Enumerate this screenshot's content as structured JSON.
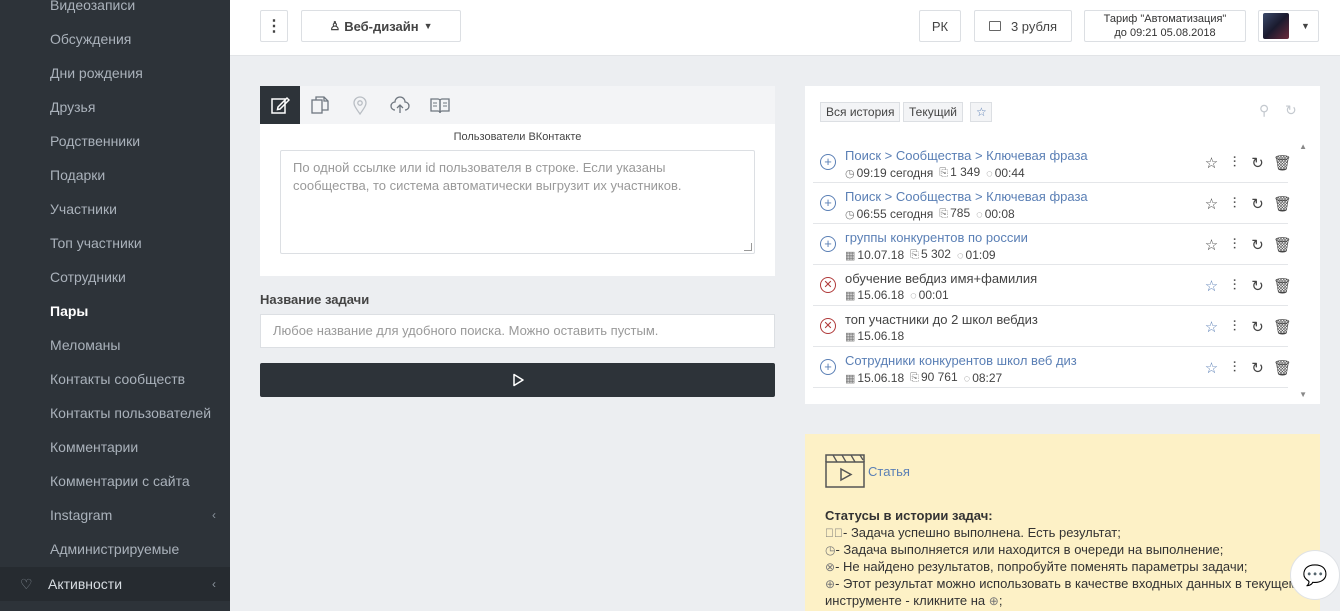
{
  "sidebar": {
    "items": [
      {
        "label": "Видеозаписи"
      },
      {
        "label": "Обсуждения"
      },
      {
        "label": "Дни рождения"
      },
      {
        "label": "Друзья"
      },
      {
        "label": "Родственники"
      },
      {
        "label": "Подарки"
      },
      {
        "label": "Участники"
      },
      {
        "label": "Топ участники"
      },
      {
        "label": "Сотрудники"
      },
      {
        "label": "Пары"
      },
      {
        "label": "Меломаны"
      },
      {
        "label": "Контакты сообществ"
      },
      {
        "label": "Контакты пользователей"
      },
      {
        "label": "Комментарии"
      },
      {
        "label": "Комментарии с сайта"
      },
      {
        "label": "Instagram"
      },
      {
        "label": "Администрируемые"
      }
    ],
    "active_item": "Пары",
    "section": {
      "label": "Активности"
    }
  },
  "topbar": {
    "menu_icon": "⋮",
    "project_label": "Веб-дизайн",
    "lang_label": "РК",
    "balance_label": "3 рубля",
    "tariff_line1": "Тариф \"Автоматизация\"",
    "tariff_line2": "до 09:21 05.08.2018"
  },
  "task": {
    "tabs": [
      "edit-icon",
      "copy-icon",
      "map-pin-icon",
      "cloud-upload-icon",
      "book-icon"
    ],
    "field_label": "Пользователи ВКонтакте",
    "textarea_placeholder": "По одной ссылке или id пользователя в строке. Если указаны сообщества, то система автоматически выгрузит их участников.",
    "name_label": "Название задачи",
    "name_placeholder": "Любое название для удобного поиска. Можно оставить пустым."
  },
  "history": {
    "filter_all": "Вся история",
    "filter_current": "Текущий",
    "rows": [
      {
        "title": "Поиск > Сообщества > Ключевая фраза",
        "status": "add",
        "date": "09:19 сегодня",
        "count": "1 349",
        "duration": "00:44",
        "starred": false
      },
      {
        "title": "Поиск > Сообщества > Ключевая фраза",
        "status": "add",
        "date": "06:55 сегодня",
        "count": "785",
        "duration": "00:08",
        "starred": false
      },
      {
        "title": "группы конкурентов по россии",
        "status": "add",
        "date": "10.07.18",
        "count": "5 302",
        "duration": "01:09",
        "starred": false
      },
      {
        "title": "обучение вебдиз имя+фамилия",
        "status": "error",
        "date": "15.06.18",
        "count": "",
        "duration": "00:01",
        "starred": true
      },
      {
        "title": "топ участники до 2 школ вебдиз",
        "status": "error",
        "date": "15.06.18",
        "count": "",
        "duration": "",
        "starred": true
      },
      {
        "title": "Сотрудники конкурентов школ веб диз",
        "status": "add",
        "date": "15.06.18",
        "count": "90 761",
        "duration": "08:27",
        "starred": true
      }
    ]
  },
  "info": {
    "article_link": "Статья",
    "statuses_title": "Статусы в истории задач:",
    "status_lines": [
      "- Задача успешно выполнена. Есть результат;",
      "- Задача выполняется или находится в очереди на выполнение;",
      "- Не найдено результатов, попробуйте поменять параметры задачи;",
      "- Этот результат можно использовать в качестве входных данных в текущем"
    ],
    "status_line_cont": "инструменте - кликните на",
    "status_line_cont_end": ";"
  },
  "colors": {
    "sidebar_bg": "#2d3339",
    "accent_blue": "#5a7fb5",
    "error_red": "#b03a3a",
    "info_bg": "#fdf1c6"
  }
}
